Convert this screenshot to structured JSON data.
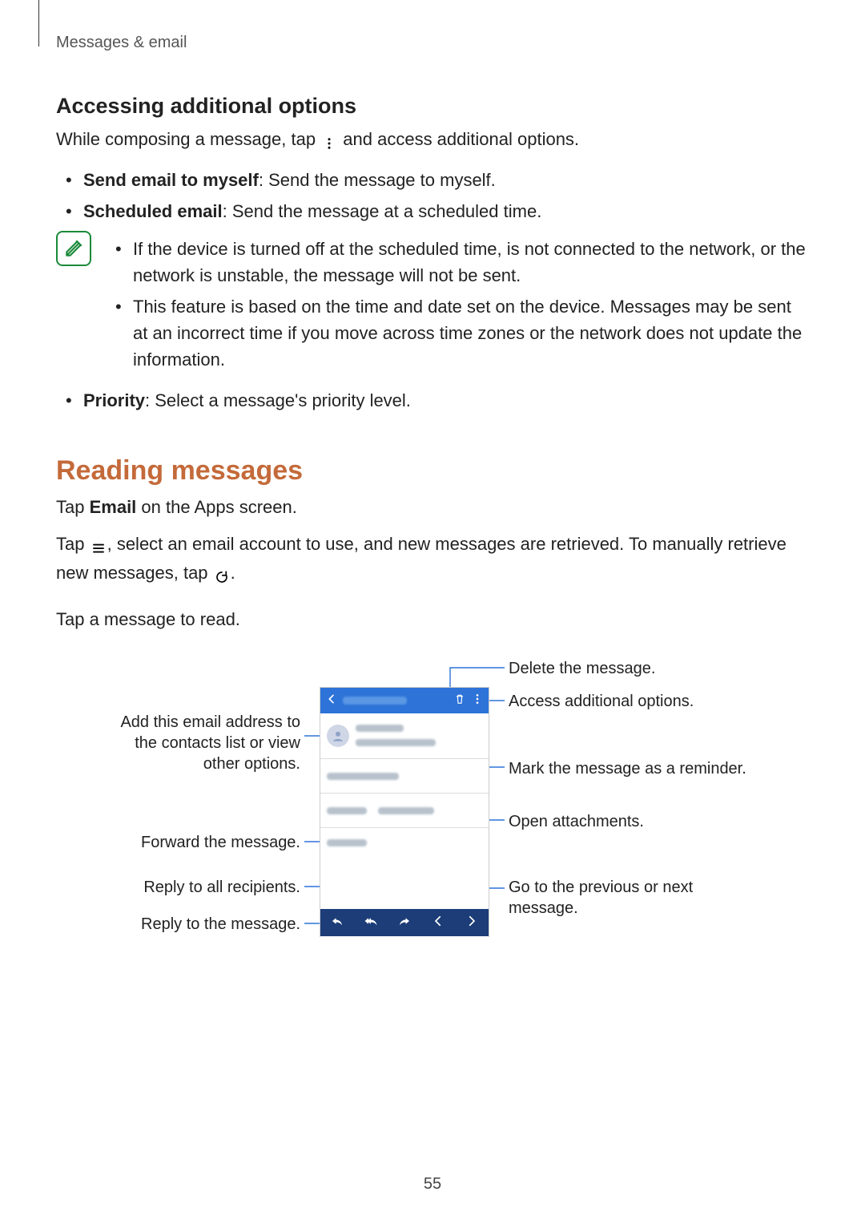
{
  "running_head": "Messages & email",
  "subhead1": "Accessing additional options",
  "intro_pre": "While composing a message, tap ",
  "intro_post": " and access additional options.",
  "b1_bold": "Send email to myself",
  "b1_rest": ": Send the message to myself.",
  "b2_bold": "Scheduled email",
  "b2_rest": ": Send the message at a scheduled time.",
  "note1": "If the device is turned off at the scheduled time, is not connected to the network, or the network is unstable, the message will not be sent.",
  "note2": "This feature is based on the time and date set on the device. Messages may be sent at an incorrect time if you move across time zones or the network does not update the information.",
  "b3_bold": "Priority",
  "b3_rest": ": Select a message's priority level.",
  "section_title": "Reading messages",
  "p1_pre": "Tap ",
  "p1_bold": "Email",
  "p1_post": " on the Apps screen.",
  "p2_pre": "Tap ",
  "p2_mid": ", select an email account to use, and new messages are retrieved. To manually retrieve new messages, tap ",
  "p2_post": ".",
  "p3": "Tap a message to read.",
  "callouts": {
    "delete": "Delete the message.",
    "options": "Access additional options.",
    "contact": "Add this email address to the contacts list or view other options.",
    "star": "Mark the message as a reminder.",
    "attach": "Open attachments.",
    "forward": "Forward the message.",
    "replyall": "Reply to all recipients.",
    "reply": "Reply to the message.",
    "prevnext": "Go to the previous or next message."
  },
  "page_number": "55"
}
